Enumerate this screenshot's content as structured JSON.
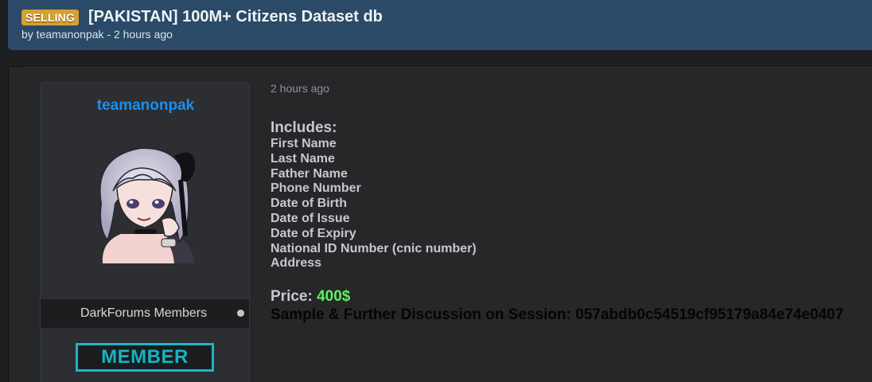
{
  "thread": {
    "prefix": "SELLING",
    "title": "[PAKISTAN] 100M+ Citizens Dataset db",
    "byline": "by teamanonpak - 2 hours ago"
  },
  "author": {
    "username": "teamanonpak",
    "usergroup": "DarkForums Members",
    "rank_badge": "MEMBER"
  },
  "post": {
    "date": "2 hours ago",
    "includes_heading": "Includes:",
    "fields": [
      "First Name",
      "Last Name",
      "Father Name",
      "Phone Number",
      "Date of Birth",
      "Date of Issue",
      "Date of Expiry",
      "National ID Number (cnic number)",
      "Address"
    ],
    "price_label": "Price:",
    "price_value": "400$",
    "sample_text": "Sample & Further Discussion on Session: 057abdb0c54519cf95179a84e74e0407"
  },
  "colors": {
    "header_bg": "#2a4a68",
    "prefix_bg": "#d4a232",
    "username": "#1a8ff0",
    "price": "#5ef05a",
    "rank_badge": "#19b7c4"
  },
  "icons": {
    "status": "status-dot-icon"
  }
}
